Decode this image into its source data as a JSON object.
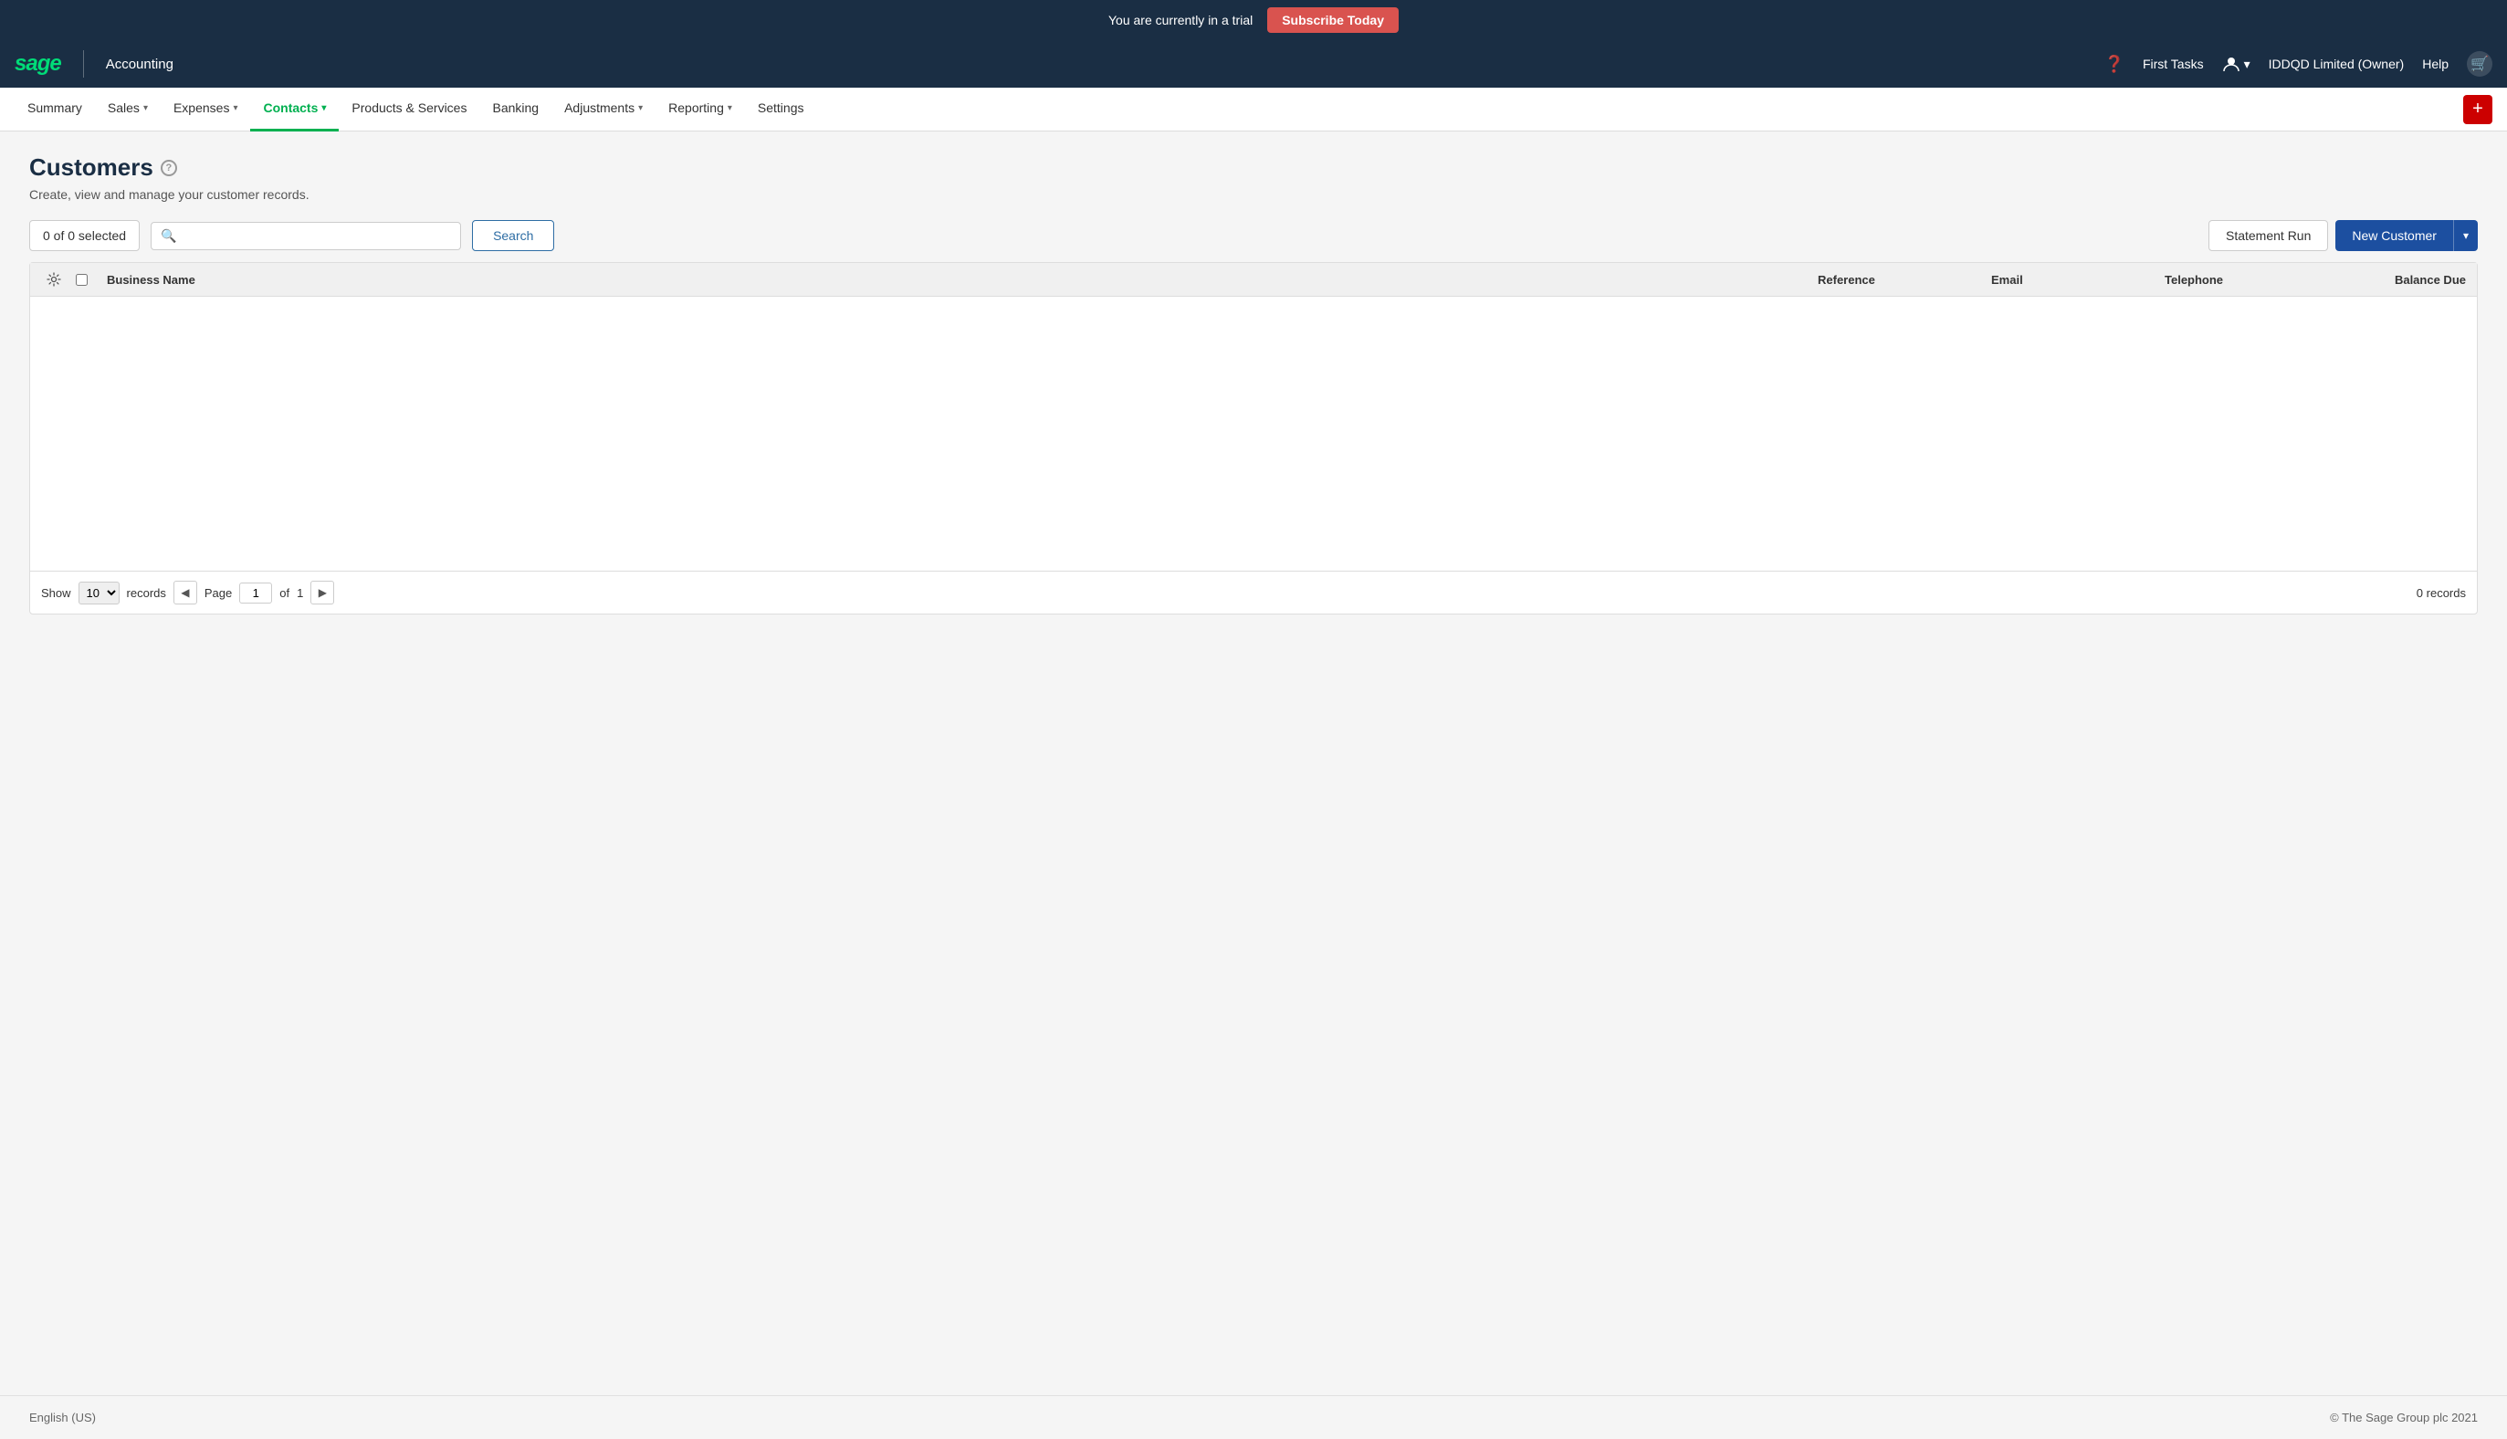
{
  "trial_banner": {
    "message": "You are currently in a trial",
    "button_label": "Subscribe Today"
  },
  "top_nav": {
    "logo": "sage",
    "app_name": "Accounting",
    "help_icon_label": "?",
    "first_tasks_label": "First Tasks",
    "user_icon_label": "👤",
    "company_label": "IDDQD Limited (Owner)",
    "help_label": "Help",
    "notification_icon_label": "🛒"
  },
  "main_nav": {
    "items": [
      {
        "label": "Summary",
        "active": false
      },
      {
        "label": "Sales",
        "active": false,
        "has_dropdown": true
      },
      {
        "label": "Expenses",
        "active": false,
        "has_dropdown": true
      },
      {
        "label": "Contacts",
        "active": true,
        "has_dropdown": true
      },
      {
        "label": "Products & Services",
        "active": false
      },
      {
        "label": "Banking",
        "active": false
      },
      {
        "label": "Adjustments",
        "active": false,
        "has_dropdown": true
      },
      {
        "label": "Reporting",
        "active": false,
        "has_dropdown": true
      },
      {
        "label": "Settings",
        "active": false
      }
    ],
    "add_button": "+"
  },
  "page": {
    "title": "Customers",
    "subtitle": "Create, view and manage your customer records.",
    "help_icon": "?"
  },
  "toolbar": {
    "selected_label": "0 of 0 selected",
    "search_placeholder": "",
    "search_button": "Search",
    "statement_run_button": "Statement Run",
    "new_customer_button": "New Customer"
  },
  "table": {
    "columns": [
      {
        "key": "business_name",
        "label": "Business Name"
      },
      {
        "key": "reference",
        "label": "Reference"
      },
      {
        "key": "email",
        "label": "Email"
      },
      {
        "key": "telephone",
        "label": "Telephone"
      },
      {
        "key": "balance_due",
        "label": "Balance Due"
      }
    ],
    "rows": []
  },
  "pagination": {
    "show_label": "Show",
    "records_per_page": "10",
    "records_label": "records",
    "page_label": "Page",
    "current_page": "1",
    "of_label": "of",
    "total_pages": "1",
    "records_count": "0 records"
  },
  "footer": {
    "language": "English (US)",
    "copyright": "© The Sage Group plc 2021"
  }
}
